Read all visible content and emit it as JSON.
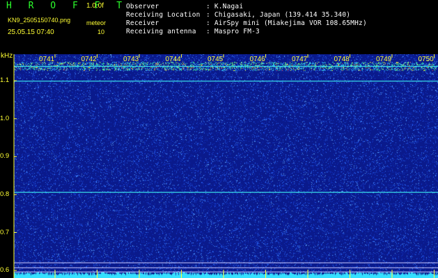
{
  "header": {
    "logo": "H R O F F T",
    "version": "1.0.0f",
    "filename": "KN9_2505150740.png",
    "datetime": "25.05.15 07:40",
    "meteor_label": "meteor",
    "meteor_count": "10",
    "fields": [
      {
        "label": "Observer",
        "value": ": K.Nagai"
      },
      {
        "label": "Receiving Location",
        "value": ": Chigasaki, Japan (139.414 35.340)"
      },
      {
        "label": "Receiver",
        "value": ": AirSpy mini (Miakejima VOR 108.65MHz)"
      },
      {
        "label": "Receiving antenna",
        "value": ": Maspro FM-3"
      }
    ]
  },
  "chart_data": {
    "type": "heatmap",
    "yunit": "kHz",
    "yticks": [
      "1.1",
      "1.0",
      "0.9",
      "0.8",
      "0.7",
      "0.6"
    ],
    "ylim": [
      0.58,
      1.17
    ],
    "xticks": [
      "0741",
      "0742",
      "0743",
      "0744",
      "0745",
      "0746",
      "0747",
      "0748",
      "0749",
      "0750"
    ],
    "carrier_lines_khz": [
      1.138,
      1.099,
      0.806,
      0.62,
      0.607,
      0.596
    ],
    "colors": {
      "background": "#0a1a8c",
      "speckle": "#2a6cff",
      "band": "#34e0ff",
      "axis": "#ffff33"
    }
  }
}
